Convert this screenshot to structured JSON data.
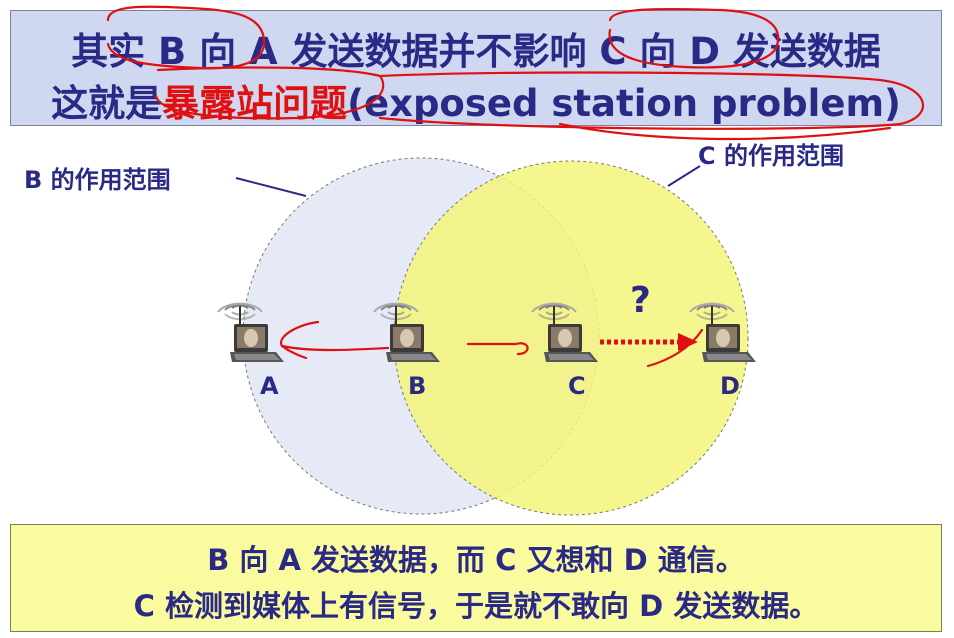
{
  "title": {
    "line1": {
      "p1": "其实 ",
      "p2": "B 向 A",
      "p3": " 发送数据并不影响 ",
      "p4": "C 向 D",
      "p5": " 发送数据"
    },
    "line2": {
      "p1": "这就是",
      "p2": "暴露站问题",
      "p3": "(exposed station problem)"
    }
  },
  "range_labels": {
    "b": "B 的作用范围",
    "c": "C 的作用范围"
  },
  "nodes": {
    "a": "A",
    "b": "B",
    "c": "C",
    "d": "D"
  },
  "question_mark": "?",
  "bottom": {
    "line1": "B 向 A 发送数据，而 C 又想和 D 通信。",
    "line2": "C 检测到媒体上有信号，于是就不敢向 D 发送数据。"
  },
  "colors": {
    "title_bg": "#cfd8f0",
    "text": "#2a2a86",
    "highlight": "#e01010",
    "b_range": "#e6eaf6",
    "c_range": "#f4f47a",
    "bottom_bg": "#fafa9e",
    "arrow": "#e01010"
  },
  "icons": [
    "laptop-icon",
    "wireless-signal-icon"
  ]
}
